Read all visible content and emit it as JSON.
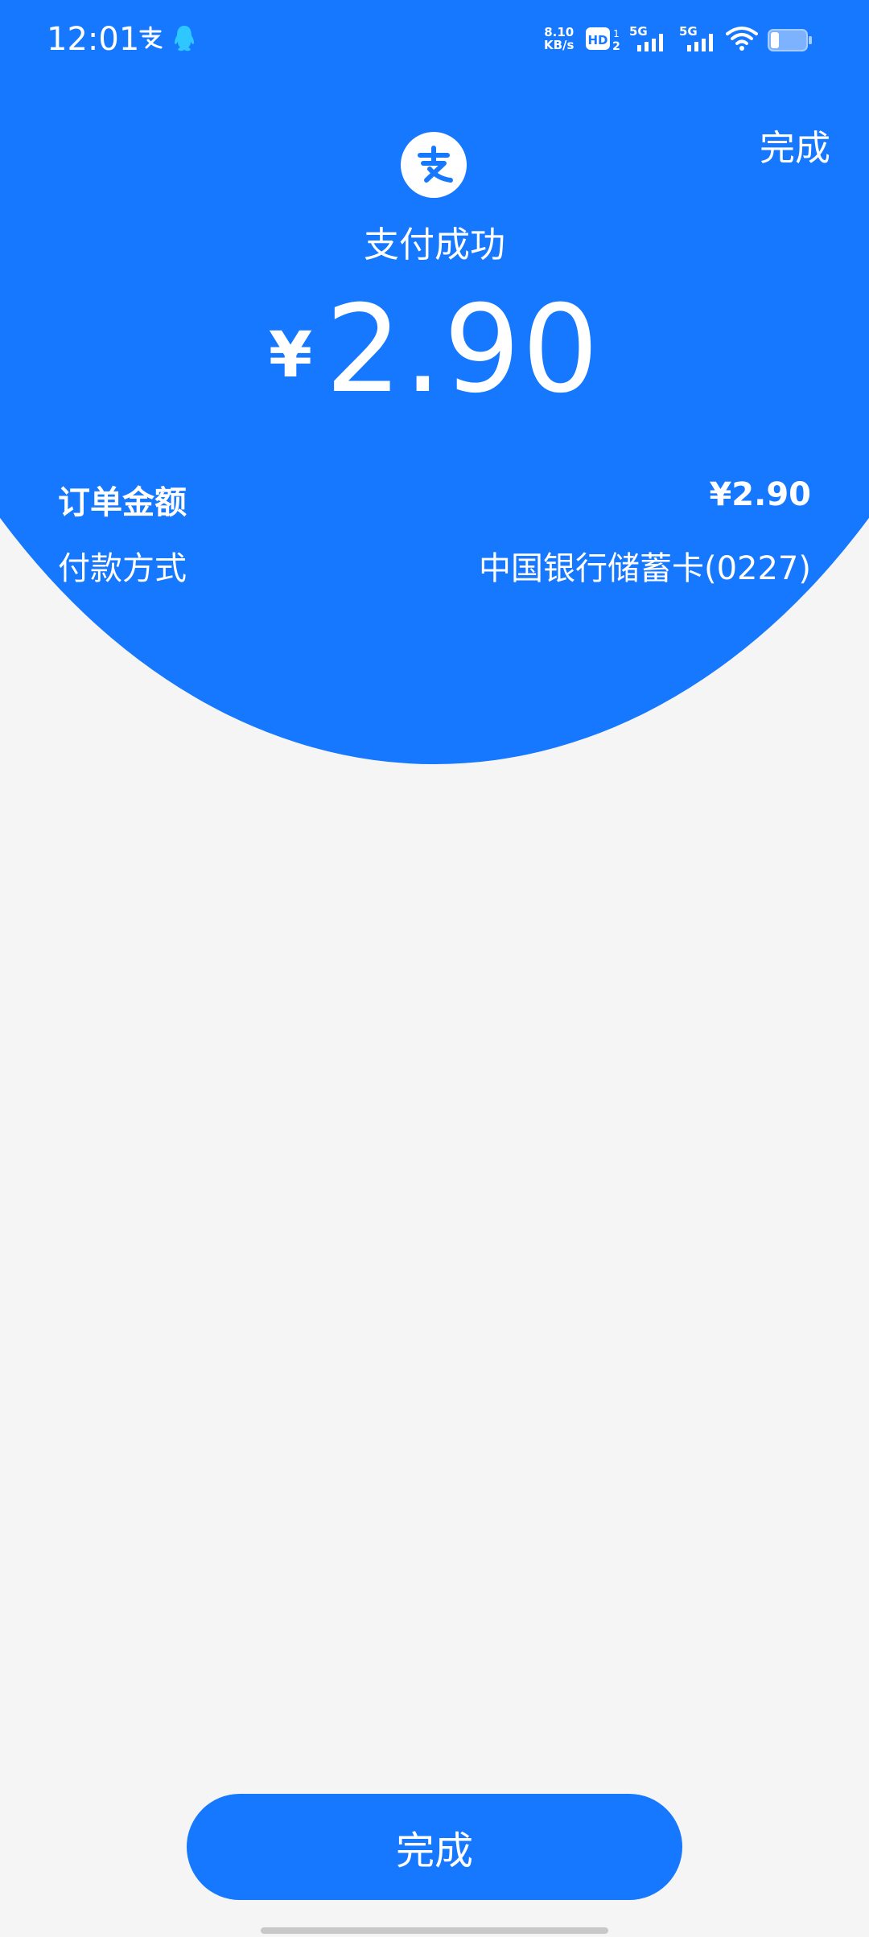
{
  "status_bar": {
    "time": "12:01",
    "speed_value": "8.10",
    "speed_unit": "KB/s",
    "hd_label": "HD",
    "sim1_label": "5G",
    "sim2_label": "5G"
  },
  "header": {
    "done_label": "完成",
    "title": "支付成功",
    "currency_symbol": "¥",
    "amount": "2.90"
  },
  "details": {
    "order_amount_label": "订单金额",
    "order_amount_value": "¥2.90",
    "payment_method_label": "付款方式",
    "payment_method_value": "中国银行储蓄卡(0227)"
  },
  "footer": {
    "done_button_label": "完成"
  },
  "colors": {
    "brand_blue": "#1677ff",
    "background": "#f5f5f5"
  }
}
